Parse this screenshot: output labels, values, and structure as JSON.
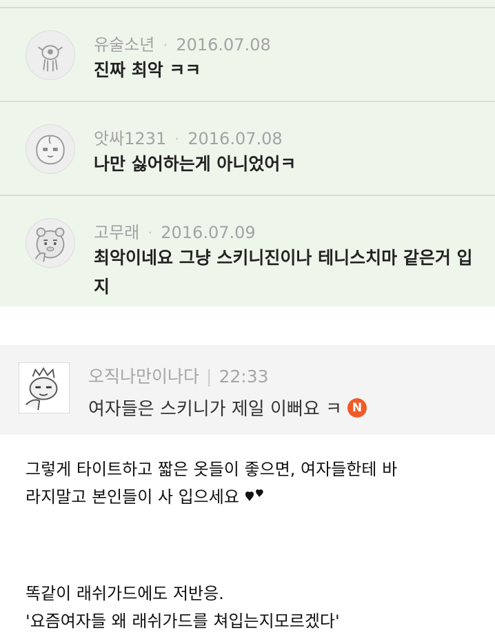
{
  "comments": [
    {
      "author": "유술소년",
      "date": "2016.07.08",
      "text": "진짜 최악 ㅋㅋ",
      "avatar_icon": "alien-character-icon"
    },
    {
      "author": "앗싸1231",
      "date": "2016.07.08",
      "text": "나만 싫어하는게 아니었어ㅋ",
      "avatar_icon": "apeach-peach-icon"
    },
    {
      "author": "고무래",
      "date": "2016.07.09",
      "text": "최악이네요 그냥 스키니진이나 테니스치마 같은거 입지",
      "avatar_icon": "ryan-lion-icon"
    }
  ],
  "featured_comment": {
    "author": "오직나만이나다",
    "time": "22:33",
    "text": "여자들은 스키니가 제일 이뻐요 ㅋ",
    "badge": "N",
    "badge_color": "#f05a28",
    "avatar_icon": "cartoon-cat-character-icon"
  },
  "post": {
    "paragraph1_line1": "그렇게 타이트하고 짧은 옷들이 좋으면, 여자들한테 바",
    "paragraph1_line2": "라지말고 본인들이 사 입으세요",
    "paragraph2_line1": "똑같이 래쉬가드에도 저반응.",
    "paragraph2_line2": "'요즘여자들 왜 래쉬가드를 쳐입는지모르겠다'"
  },
  "colors": {
    "green_panel": "#eef6ec",
    "grey_panel": "#f4f4f4",
    "meta_text": "#a3a3a3"
  }
}
